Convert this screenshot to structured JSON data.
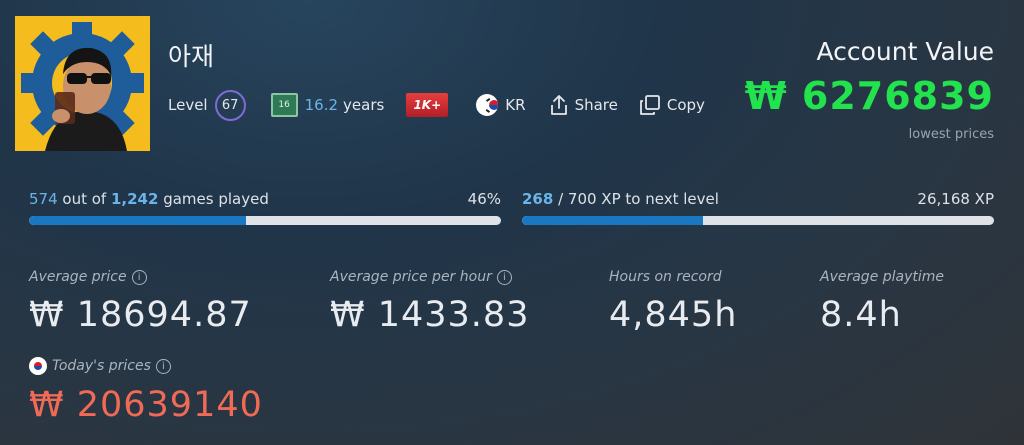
{
  "profile": {
    "username": "아재",
    "level_label": "Level",
    "level": "67",
    "years_icon_text": "16",
    "years_value": "16.2",
    "years_label": "years",
    "games_badge": "1K+",
    "country": "KR",
    "share_label": "Share",
    "copy_label": "Copy"
  },
  "account": {
    "title": "Account Value",
    "value": "₩ 6276839",
    "note": "lowest prices"
  },
  "games_progress": {
    "played": "574",
    "mid_text": " out of ",
    "total": "1,242",
    "suffix": " games played",
    "percent_label": "46%",
    "fraction": 0.46
  },
  "xp_progress": {
    "current": "268",
    "suffix": " / 700 XP to next level",
    "total_xp": "26,168 XP",
    "fraction": 0.383
  },
  "stats": {
    "avg_price_label": "Average price",
    "avg_price_value": "₩ 18694.87",
    "avg_price_hour_label": "Average price per hour",
    "avg_price_hour_value": "₩ 1433.83",
    "hours_label": "Hours on record",
    "hours_value": "4,845h",
    "playtime_label": "Average playtime",
    "playtime_value": "8.4h",
    "today_label": "Today's prices",
    "today_value": "₩ 20639140"
  },
  "colors": {
    "account_value": "#22e24d",
    "today_value": "#f06a55",
    "progress_fill": "#1a78c2",
    "highlight_blue": "#6ab4ea",
    "level_ring": "#7f6bd6"
  }
}
